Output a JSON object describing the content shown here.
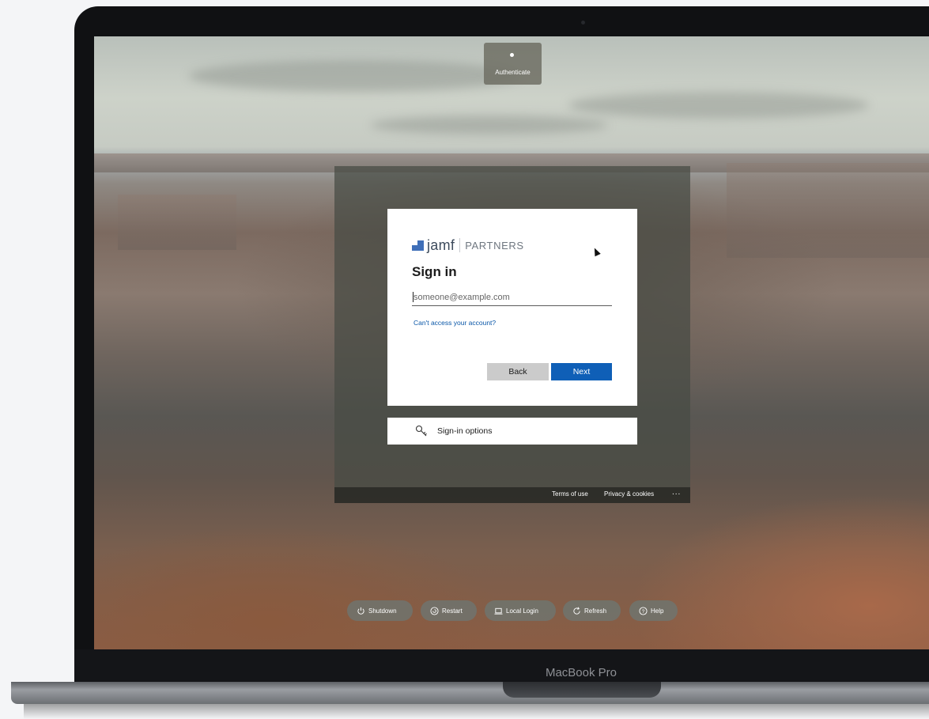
{
  "device": {
    "label": "MacBook Pro"
  },
  "auth_indicator": {
    "label": "Authenticate"
  },
  "signin_card": {
    "logo_word": "jamf",
    "logo_partners": "PARTNERS",
    "title": "Sign in",
    "email_placeholder": "someone@example.com",
    "email_value": "",
    "cant_access_link": "Can't access your account?",
    "back_button": "Back",
    "next_button": "Next"
  },
  "signin_options": {
    "label": "Sign-in options",
    "icon": "key-icon"
  },
  "footer": {
    "terms": "Terms of use",
    "privacy": "Privacy & cookies",
    "more": "..."
  },
  "system_buttons": [
    {
      "label": "Shutdown",
      "icon": "power-icon"
    },
    {
      "label": "Restart",
      "icon": "restart-icon"
    },
    {
      "label": "Local Login",
      "icon": "laptop-icon"
    },
    {
      "label": "Refresh",
      "icon": "refresh-icon"
    },
    {
      "label": "Help",
      "icon": "help-icon"
    }
  ],
  "colors": {
    "accent": "#0f5fb7",
    "jamf_mark": "#3f6fb8"
  }
}
